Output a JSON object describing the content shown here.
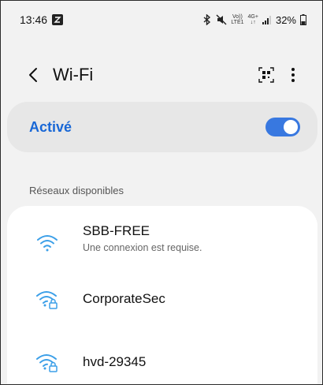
{
  "status_bar": {
    "time": "13:46",
    "battery": "32%",
    "indicators": [
      "bluetooth-icon",
      "mute-icon",
      "volte-icon",
      "lte-4g-icon",
      "signal-icon",
      "battery-icon"
    ],
    "volte_line1": "Vo))",
    "volte_line2": "LTE1",
    "net_line1": "4G+",
    "net_line2": "↓↑"
  },
  "header": {
    "title": "Wi-Fi"
  },
  "master_toggle": {
    "label": "Activé",
    "on": true
  },
  "available_networks": {
    "header": "Réseaux disponibles",
    "items": [
      {
        "name": "SBB-FREE",
        "status": "Une connexion est requise.",
        "secured": false
      },
      {
        "name": "CorporateSec",
        "status": "",
        "secured": true
      },
      {
        "name": "hvd-29345",
        "status": "",
        "secured": true
      }
    ]
  },
  "colors": {
    "accent": "#1867d6",
    "wifi_icon": "#3b9fe8",
    "switch": "#3878e0"
  }
}
